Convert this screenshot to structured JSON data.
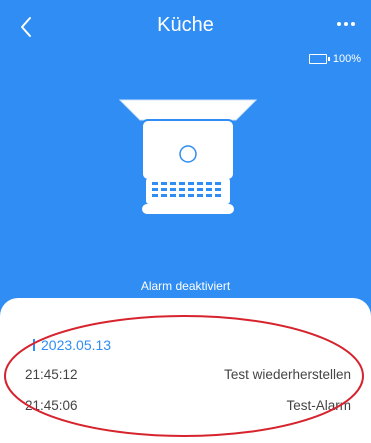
{
  "header": {
    "title": "Küche",
    "back_icon": "chevron-left-icon",
    "more_icon": "more-dots-icon"
  },
  "battery": {
    "level": "100%",
    "icon": "battery-icon"
  },
  "device": {
    "icon": "smoke-detector-icon"
  },
  "status": {
    "text": "Alarm deaktiviert"
  },
  "history": {
    "date": "2023.05.13",
    "entries": [
      {
        "time": "21:45:12",
        "event": "Test wiederherstellen"
      },
      {
        "time": "21:45:06",
        "event": "Test-Alarm"
      }
    ]
  },
  "colors": {
    "primary": "#2f8df4",
    "annotation": "#d6232d"
  }
}
